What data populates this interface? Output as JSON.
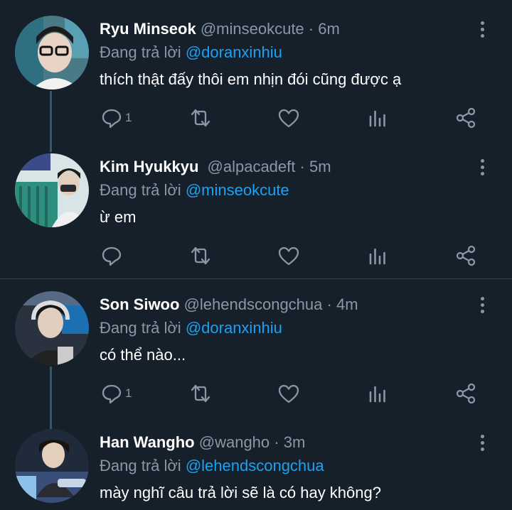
{
  "reply_prefix": "Đang trả lời",
  "colors": {
    "background": "#15202b",
    "muted": "#8899a6",
    "mention": "#1da1f2",
    "divider": "#38444d"
  },
  "icons": [
    "reply-icon",
    "retweet-icon",
    "like-icon",
    "analytics-icon",
    "share-icon",
    "more-icon"
  ],
  "tweets": [
    {
      "name": "Ryu Minseok",
      "handle": "@minseokcute",
      "time": "6m",
      "reply_to": "@doranxinhiu",
      "text": "thích thật đấy thôi em nhịn đói cũng được ạ",
      "reply_count": "1"
    },
    {
      "name": "Kim Hyukkyu",
      "handle": "@alpacadeft",
      "time": "5m",
      "reply_to": "@minseokcute",
      "text": "ừ em",
      "reply_count": ""
    },
    {
      "name": "Son Siwoo",
      "handle": "@lehendscongchua",
      "time": "4m",
      "reply_to": "@doranxinhiu",
      "text": "có thể nào...",
      "reply_count": "1"
    },
    {
      "name": "Han Wangho",
      "handle": "@wangho",
      "time": "3m",
      "reply_to": "@lehendscongchua",
      "text": "mày nghĩ câu trả lời sẽ là có hay không?",
      "reply_count": ""
    }
  ]
}
